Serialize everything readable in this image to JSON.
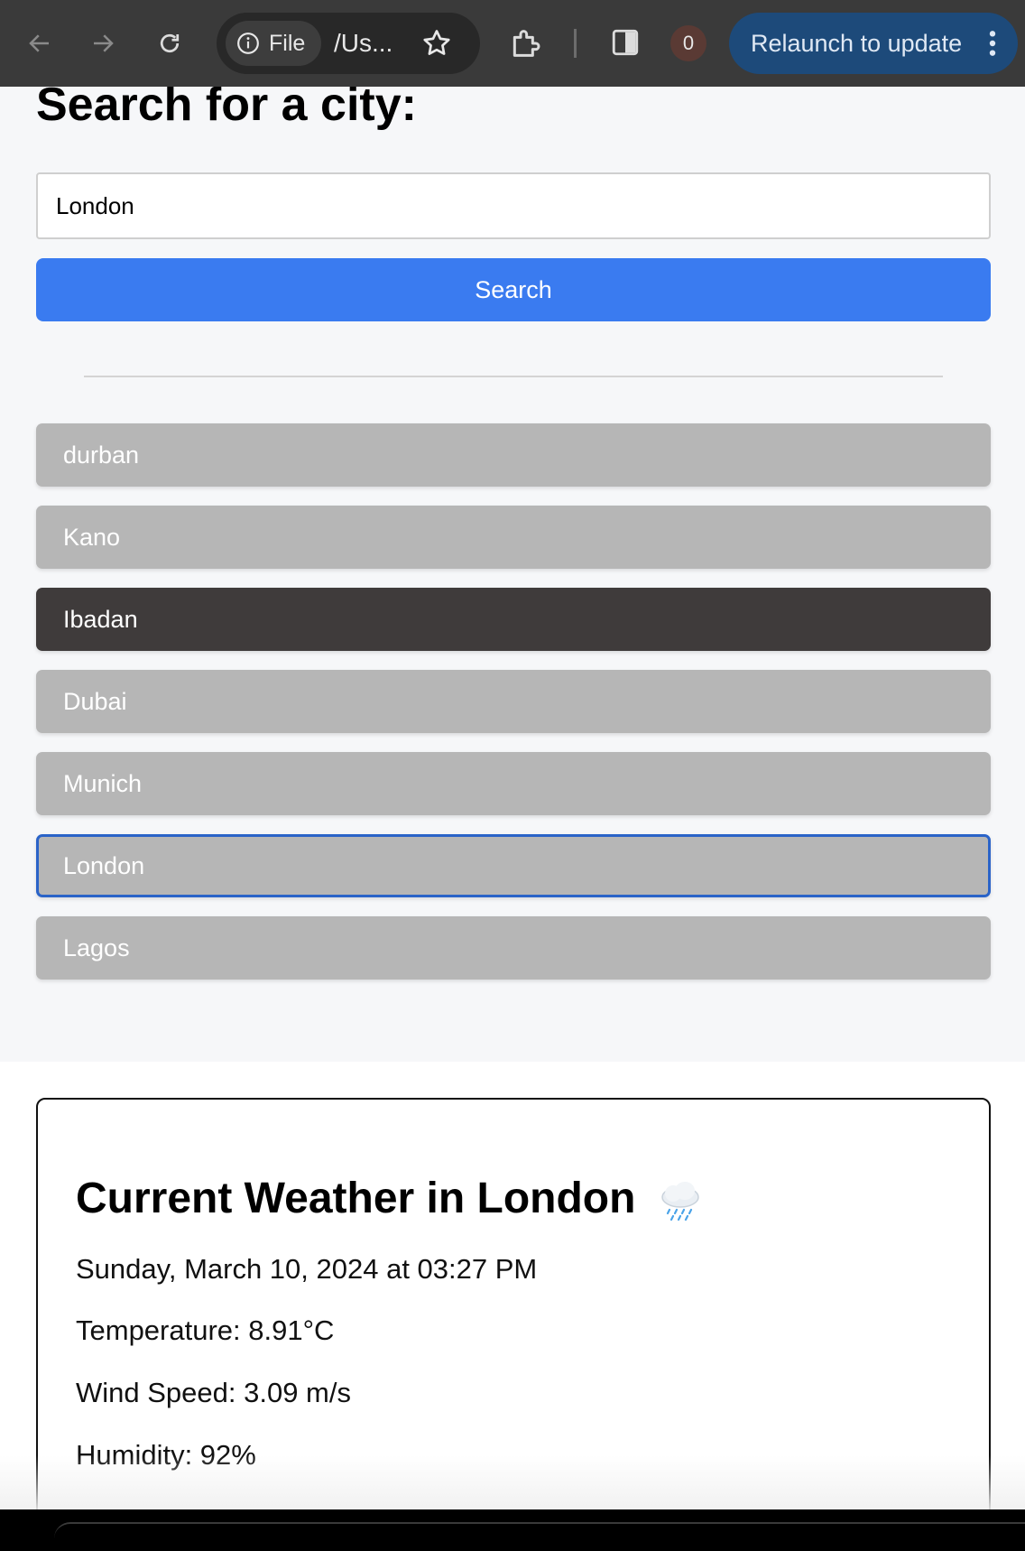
{
  "browser": {
    "site_chip_label": "File",
    "url": "/Us...",
    "notification_count": "0",
    "relaunch_label": "Relaunch to update"
  },
  "search": {
    "heading": "Search for a city:",
    "input_value": "London",
    "button_label": "Search"
  },
  "cities": [
    {
      "label": "durban"
    },
    {
      "label": "Kano"
    },
    {
      "label": "Ibadan"
    },
    {
      "label": "Dubai"
    },
    {
      "label": "Munich"
    },
    {
      "label": "London"
    },
    {
      "label": "Lagos"
    }
  ],
  "weather": {
    "title": "Current Weather in London",
    "icon": "rain-cloud-icon",
    "datetime": "Sunday, March 10, 2024 at 03:27 PM",
    "temperature": "Temperature: 8.91°C",
    "wind_speed": "Wind Speed: 3.09 m/s",
    "humidity": "Humidity: 92%"
  },
  "colors": {
    "primary_button": "#3a7bf0",
    "city_item": "#b6b6b6",
    "city_item_active": "#3f3b3b",
    "focus_outline": "#2a63c8",
    "toolbar": "#3a3a3a",
    "relaunch_button": "#1d4a7a"
  }
}
